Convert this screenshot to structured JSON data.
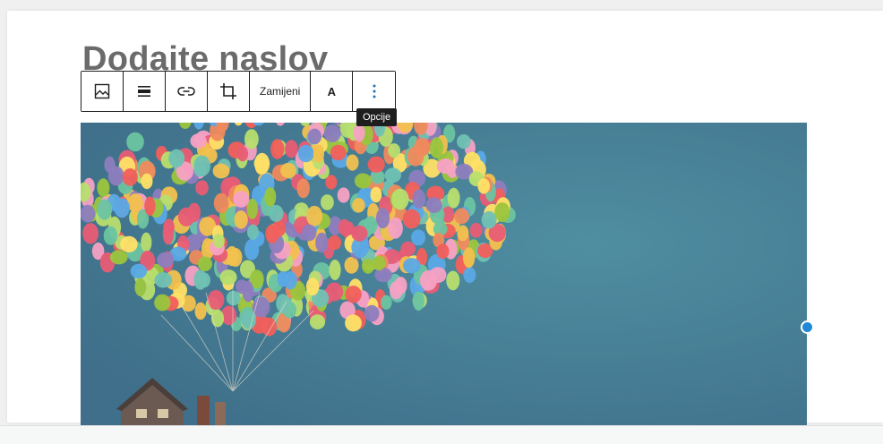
{
  "editor": {
    "title": "Dodaite naslov"
  },
  "toolbar": {
    "buttons": [
      {
        "id": "image",
        "icon": "image-icon",
        "label": ""
      },
      {
        "id": "align",
        "icon": "align-justify-icon",
        "label": ""
      },
      {
        "id": "link",
        "icon": "link-icon",
        "label": ""
      },
      {
        "id": "crop",
        "icon": "crop-icon",
        "label": ""
      },
      {
        "id": "replace",
        "icon": "",
        "label": "Zamijeni"
      },
      {
        "id": "text",
        "icon": "",
        "label": "A"
      },
      {
        "id": "options",
        "icon": "vertical-ellipsis-icon",
        "label": ""
      }
    ],
    "tooltip": "Opcije"
  },
  "image": {
    "alt_icon": "balloons-house-image",
    "sky_color": "#41758f",
    "selection_color": "#1e88d6"
  }
}
